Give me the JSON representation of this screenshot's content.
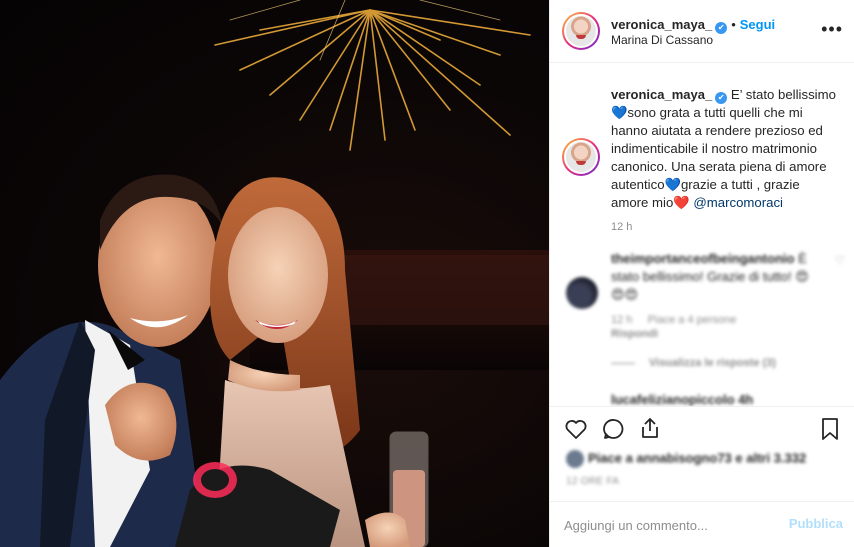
{
  "post": {
    "username": "veronica_maya_",
    "follow_label": "Segui",
    "location": "Marina Di Cassano",
    "more_icon": "more-horizontal-icon"
  },
  "caption": {
    "username": "veronica_maya_",
    "text_1": "E’ stato bellissimo",
    "heart_1": "💙",
    "text_2": "sono grata a tutti quelli che mi hanno aiutata a rendere prezioso ed indimenticabile il nostro matrimonio canonico. Una serata piena di amore autentico",
    "heart_2": "💙",
    "text_3": "grazie a tutti , grazie amore mio",
    "heart_3": "❤️",
    "mention": "@marcomoraci",
    "time": "12 h"
  },
  "comment_1": {
    "username": "theimportanceofbeingantonio",
    "text": "È stato bellissimo! Grazie di tutto!",
    "emojis": "😍😍😍",
    "time": "12 h",
    "likes": "Piace a 4 persone",
    "reply": "Rispondi",
    "view_replies": "Visualizza le risposte (3)"
  },
  "comment_2": {
    "username": "lucafelizianopiccolo 4h"
  },
  "actions": {
    "likes_text": "Piace a annabisogno73 e altri 3.332",
    "date": "12 ORE FA"
  },
  "comment_box": {
    "placeholder": "Aggiungi un commento...",
    "publish_label": "Pubblica"
  },
  "colors": {
    "accent": "#0095f6",
    "publish_disabled": "#b2dffc",
    "text": "#262626",
    "muted": "#8e8e8e"
  }
}
